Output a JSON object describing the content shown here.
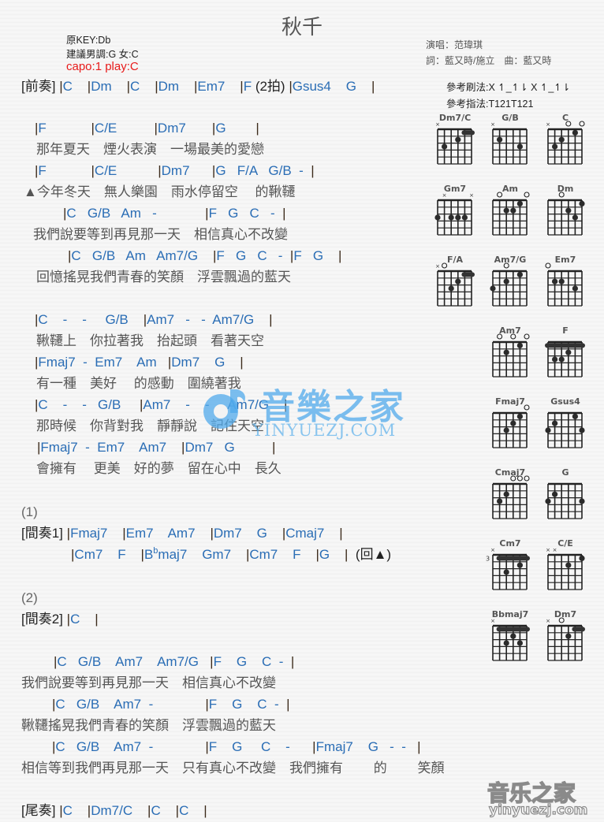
{
  "header": {
    "title": "秋千",
    "original_key": "原KEY:Db",
    "suggested_key": "建議男調:G 女:C",
    "capo": "capo:1 play:C",
    "singer": "演唱：范瑋琪",
    "writers": "詞：藍又時/施立　曲：藍又時",
    "strum_pattern": "參考刷法:X ↿_↿⇂ X ↿_↿⇂",
    "finger_pattern": "參考指法:T121T121"
  },
  "sheet": [
    {
      "type": "chords",
      "text": "[前奏] |C    |Dm    |C    |Dm    |Em7    |F (2拍) |Gsus4    G    |"
    },
    {
      "type": "chords",
      "text": "|F            |C/E          |Dm7       |G        |"
    },
    {
      "type": "lyric",
      "text": "那年夏天　煙火表演　一場最美的愛戀"
    },
    {
      "type": "chords",
      "text": "|F            |C/E           |Dm7      |G   F/A   G/B  -  |"
    },
    {
      "type": "lyric",
      "text": "▲今年冬天　無人樂園　雨水停留空　 的鞦韆"
    },
    {
      "type": "chords",
      "text": "|C   G/B   Am   -             |F   G   C   -  |"
    },
    {
      "type": "lyric",
      "text": "我們說要等到再見那一天　相信真心不改變"
    },
    {
      "type": "chords",
      "text": "|C   G/B   Am   Am7/G    |F   G   C   -  |F   G    |"
    },
    {
      "type": "lyric",
      "text": "回憶搖晃我們青春的笑顏　浮雲飄過的藍天"
    },
    {
      "type": "chords",
      "text": "|C    -    -     G/B    |Am7   -   -  Am7/G    |"
    },
    {
      "type": "lyric",
      "text": "鞦韆上　你拉著我　抬起頭　看著天空"
    },
    {
      "type": "chords",
      "text": "|Fmaj7  -  Em7    Am   |Dm7    G    |"
    },
    {
      "type": "lyric",
      "text": "有一種　美好　 的感動　圍繞著我"
    },
    {
      "type": "chords",
      "text": "|C    -    -   G/B     |Am7    -    -     Am7/G    |"
    },
    {
      "type": "lyric",
      "text": "那時候　你背對我　靜靜說　記住天空"
    },
    {
      "type": "chords",
      "text": "|Fmaj7  -  Em7    Am7    |Dm7   G          |"
    },
    {
      "type": "lyric",
      "text": "會擁有　 更美　好的夢　留在心中　長久"
    },
    {
      "type": "paren",
      "text": "(1)"
    },
    {
      "type": "chords",
      "text": "[間奏1] |Fmaj7    |Em7    Am7    |Dm7    G    |Cmaj7    |"
    },
    {
      "type": "chords",
      "text": "|Cm7    F    |B{b}maj7    Gm7    |Cm7    F    |G    |  (回▲)"
    },
    {
      "type": "paren",
      "text": "(2)"
    },
    {
      "type": "chords",
      "text": "[間奏2] |C    |"
    },
    {
      "type": "chords",
      "text": "|C   G/B    Am7    Am7/G   |F    G    C  -  |"
    },
    {
      "type": "lyric",
      "text": "我們說要等到再見那一天　相信真心不改變"
    },
    {
      "type": "chords",
      "text": "|C   G/B    Am7  -              |F    G    C  -  |"
    },
    {
      "type": "lyric",
      "text": "鞦韆搖晃我們青春的笑顏　浮雲飄過的藍天"
    },
    {
      "type": "chords",
      "text": "|C   G/B    Am7  -              |F    G     C    -      |Fmaj7    G   -  -   |"
    },
    {
      "type": "lyric",
      "text": "相信等到我們再見那一天　只有真心不改變　我們擁有　　 的　　 笑顏"
    },
    {
      "type": "chords",
      "text": "[尾奏] |C    |Dm7/C    |C    |C    |"
    }
  ],
  "chord_diagrams": [
    {
      "name": "Dm7/C",
      "muted": [
        6
      ],
      "open": [],
      "barre": {
        "fret": 1,
        "from": 2,
        "to": 1
      },
      "dots": [
        [
          3,
          2
        ],
        [
          5,
          3
        ]
      ]
    },
    {
      "name": "G/B",
      "muted": [
        6
      ],
      "open": [],
      "dots": [
        [
          5,
          2
        ],
        [
          2,
          3
        ]
      ]
    },
    {
      "name": "C",
      "muted": [
        6
      ],
      "open": [
        3,
        1
      ],
      "dots": [
        [
          5,
          3
        ],
        [
          4,
          2
        ],
        [
          2,
          1
        ]
      ]
    },
    {
      "name": "Gm7",
      "muted": [
        5,
        1
      ],
      "open": [],
      "dots": [
        [
          6,
          3
        ],
        [
          4,
          3
        ],
        [
          3,
          3
        ],
        [
          2,
          3
        ]
      ]
    },
    {
      "name": "Am",
      "muted": [],
      "open": [
        5,
        1
      ],
      "dots": [
        [
          4,
          2
        ],
        [
          3,
          2
        ],
        [
          2,
          1
        ]
      ]
    },
    {
      "name": "Dm",
      "muted": [],
      "open": [
        4
      ],
      "dots": [
        [
          3,
          2
        ],
        [
          2,
          3
        ],
        [
          1,
          1
        ]
      ]
    },
    {
      "name": "F/A",
      "muted": [
        6
      ],
      "open": [
        5
      ],
      "barre": {
        "fret": 1,
        "from": 2,
        "to": 1
      },
      "dots": [
        [
          4,
          3
        ],
        [
          3,
          2
        ]
      ]
    },
    {
      "name": "Am7/G",
      "muted": [],
      "open": [
        4
      ],
      "dots": [
        [
          6,
          3
        ],
        [
          4,
          2
        ],
        [
          2,
          1
        ]
      ]
    },
    {
      "name": "Em7",
      "muted": [],
      "open": [
        6
      ],
      "dots": [
        [
          5,
          2
        ],
        [
          4,
          2
        ],
        [
          2,
          3
        ]
      ]
    },
    {
      "name": "Am7",
      "muted": [],
      "open": [
        5,
        3,
        1
      ],
      "dots": [
        [
          4,
          2
        ],
        [
          2,
          1
        ]
      ]
    },
    {
      "name": "F",
      "muted": [],
      "open": [],
      "barre": {
        "fret": 1,
        "from": 6,
        "to": 1
      },
      "dots": [
        [
          5,
          3
        ],
        [
          4,
          3
        ],
        [
          3,
          2
        ]
      ]
    },
    {
      "name": "Fmaj7",
      "muted": [],
      "open": [
        1
      ],
      "dots": [
        [
          4,
          3
        ],
        [
          3,
          2
        ],
        [
          2,
          1
        ]
      ]
    },
    {
      "name": "Gsus4",
      "muted": [],
      "open": [],
      "dots": [
        [
          6,
          3
        ],
        [
          5,
          2
        ],
        [
          2,
          1
        ],
        [
          1,
          3
        ]
      ]
    },
    {
      "name": "Cmaj7",
      "muted": [],
      "open": [
        3,
        2,
        1
      ],
      "dots": [
        [
          5,
          3
        ],
        [
          4,
          2
        ]
      ]
    },
    {
      "name": "G",
      "muted": [],
      "open": [],
      "dots": [
        [
          6,
          3
        ],
        [
          5,
          2
        ],
        [
          1,
          3
        ]
      ]
    },
    {
      "name": "Cm7",
      "muted": [
        6
      ],
      "open": [],
      "base_fret": "3",
      "barre": {
        "fret": 1,
        "from": 5,
        "to": 1
      },
      "dots": [
        [
          4,
          3
        ],
        [
          2,
          2
        ]
      ]
    },
    {
      "name": "C/E",
      "muted": [
        6,
        5
      ],
      "open": [],
      "dots": [
        [
          3,
          2
        ],
        [
          1,
          1
        ]
      ]
    },
    {
      "name": "Bbmaj7",
      "muted": [
        6
      ],
      "open": [],
      "barre": {
        "fret": 1,
        "from": 5,
        "to": 1
      },
      "dots": [
        [
          4,
          3
        ],
        [
          3,
          2
        ],
        [
          2,
          3
        ]
      ]
    },
    {
      "name": "Dm7",
      "muted": [
        6
      ],
      "open": [
        4
      ],
      "barre": {
        "fret": 1,
        "from": 2,
        "to": 1
      },
      "dots": [
        [
          3,
          2
        ]
      ]
    }
  ],
  "watermarks": {
    "center_cn": "音樂之家",
    "center_en": "YINYUEZJ.COM",
    "corner_cn": "音乐之家",
    "corner_en": "yinyuezj.com"
  }
}
